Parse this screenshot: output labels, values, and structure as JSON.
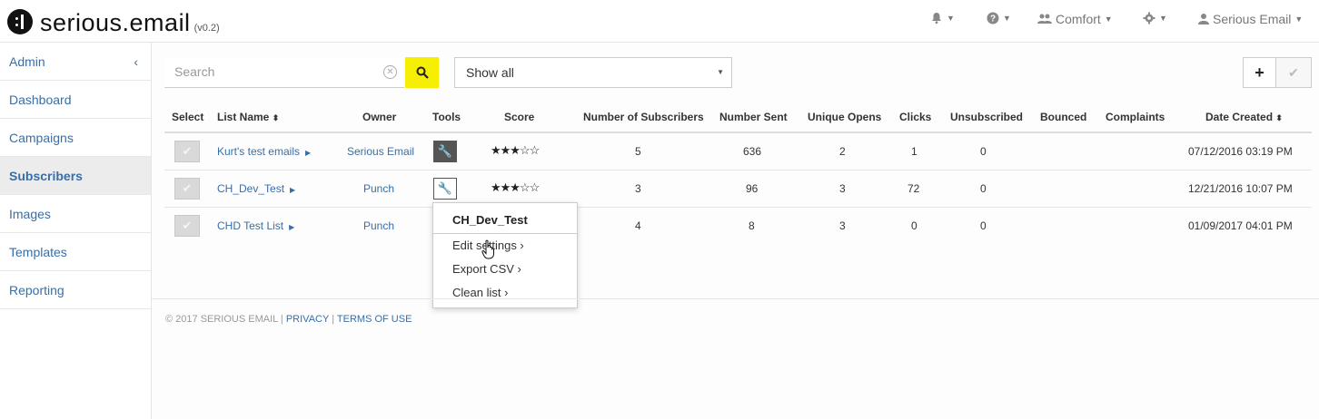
{
  "header": {
    "logo_text": "serious.email",
    "version": "(v0.2)",
    "comfort_label": "Comfort",
    "user_label": "Serious Email"
  },
  "sidebar": {
    "items": [
      {
        "label": "Admin"
      },
      {
        "label": "Dashboard"
      },
      {
        "label": "Campaigns"
      },
      {
        "label": "Subscribers"
      },
      {
        "label": "Images"
      },
      {
        "label": "Templates"
      },
      {
        "label": "Reporting"
      }
    ],
    "active": "Subscribers"
  },
  "toolbar": {
    "search_placeholder": "Search",
    "filter_value": "Show all",
    "add_label": "+",
    "apply_label": "✔"
  },
  "table": {
    "headers": {
      "select": "Select",
      "list_name": "List Name",
      "owner": "Owner",
      "tools": "Tools",
      "score": "Score",
      "subscribers": "Number of Subscribers",
      "sent": "Number Sent",
      "opens": "Unique Opens",
      "clicks": "Clicks",
      "unsubscribed": "Unsubscribed",
      "bounced": "Bounced",
      "complaints": "Complaints",
      "date_created": "Date Created"
    },
    "rows": [
      {
        "name": "Kurt's test emails",
        "owner": "Serious Email",
        "score": "★★★☆☆",
        "subscribers": "5",
        "sent": "636",
        "opens": "2",
        "clicks": "1",
        "unsubscribed": "0",
        "bounced": "",
        "complaints": "",
        "date": "07/12/2016 03:19 PM"
      },
      {
        "name": "CH_Dev_Test",
        "owner": "Punch",
        "score": "★★★☆☆",
        "subscribers": "3",
        "sent": "96",
        "opens": "3",
        "clicks": "72",
        "unsubscribed": "0",
        "bounced": "",
        "complaints": "",
        "date": "12/21/2016 10:07 PM"
      },
      {
        "name": "CHD Test List",
        "owner": "Punch",
        "score": "",
        "subscribers": "4",
        "sent": "8",
        "opens": "3",
        "clicks": "0",
        "unsubscribed": "0",
        "bounced": "",
        "complaints": "",
        "date": "01/09/2017 04:01 PM"
      }
    ]
  },
  "tools_menu": {
    "title": "CH_Dev_Test",
    "items": [
      {
        "label": "Edit settings ›"
      },
      {
        "label": "Export CSV ›"
      },
      {
        "label": "Clean list ›"
      }
    ]
  },
  "footer": {
    "copyright": "© 2017 SERIOUS EMAIL |",
    "privacy": "PRIVACY",
    "separator": "|",
    "terms": "TERMS OF USE"
  },
  "colors": {
    "accent_link": "#3a6ea5",
    "search_button": "#f6f000",
    "active_sidebar_bg": "#ececec"
  }
}
